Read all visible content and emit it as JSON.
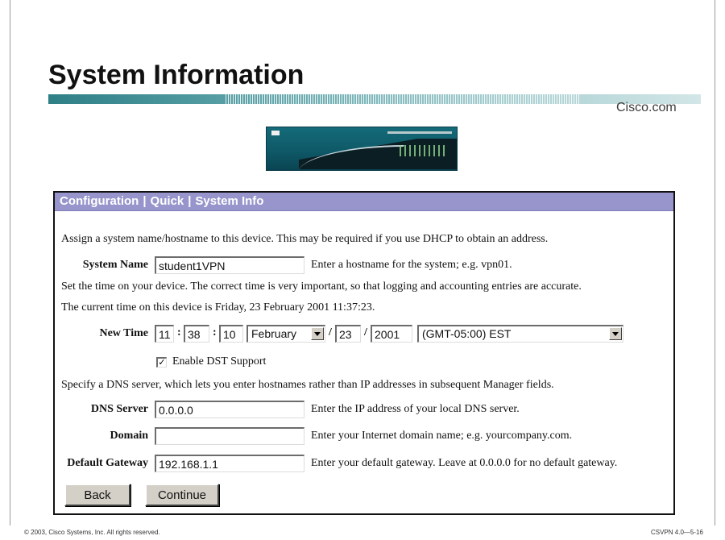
{
  "slide": {
    "title": "System Information",
    "brand_link": "Cisco.com",
    "footer_left": "© 2003, Cisco Systems, Inc. All rights reserved.",
    "footer_right": "CSVPN 4.0—5-16"
  },
  "panel": {
    "breadcrumb": [
      "Configuration",
      "Quick",
      "System Info"
    ],
    "breadcrumb_separator": "|",
    "header_color": "#9795cc",
    "intro_text": "Assign a system name/hostname to this device. This may be required if you use DHCP to obtain an address.",
    "system_name": {
      "label": "System Name",
      "value": "student1VPN",
      "hint": "Enter a hostname for the system; e.g. vpn01."
    },
    "time_text": "Set the time on your device. The correct time is very important, so that logging and accounting entries are accurate.",
    "current_time_text": "The current time on this device is Friday, 23 February 2001 11:37:23.",
    "new_time": {
      "label": "New Time",
      "hour": "11",
      "minute": "38",
      "second": "10",
      "time_separator": ":",
      "month": "February",
      "day": "23",
      "year": "2001",
      "date_separator": "/",
      "timezone": "(GMT-05:00) EST"
    },
    "dst": {
      "label": "Enable DST Support",
      "checked": true,
      "check_glyph": "✓"
    },
    "dns_text": "Specify a DNS server, which lets you enter hostnames rather than IP addresses in subsequent Manager fields.",
    "dns_server": {
      "label": "DNS Server",
      "value": "0.0.0.0",
      "hint": "Enter the IP address of your local DNS server."
    },
    "domain": {
      "label": "Domain",
      "value": "",
      "hint": "Enter your Internet domain name; e.g. yourcompany.com."
    },
    "default_gateway": {
      "label": "Default Gateway",
      "value": "192.168.1.1",
      "hint": "Enter your default gateway. Leave at 0.0.0.0 for no default gateway."
    },
    "buttons": {
      "back": "Back",
      "continue": "Continue"
    }
  }
}
